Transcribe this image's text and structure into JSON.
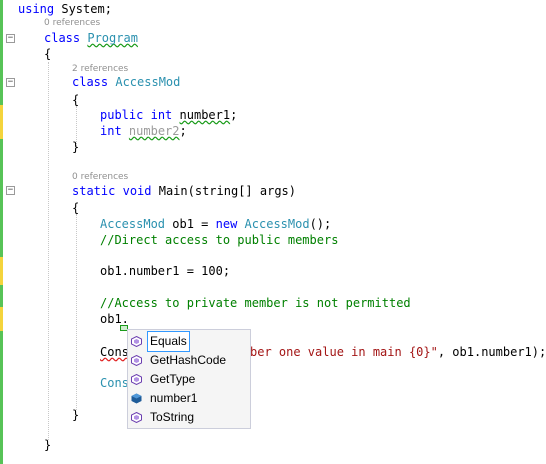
{
  "code": {
    "line_using": "using System;",
    "ref0": "0 references",
    "line_class_kw": "class",
    "line_class_name": "Program",
    "brace_open": "{",
    "brace_close": "}",
    "ref2": "2 references",
    "line_acc_kw": "class",
    "line_acc_name": "AccessMod",
    "public_kw": "public",
    "int_kw": "int",
    "number1_name": "number1",
    "semicolon": ";",
    "number2_name": "number2",
    "ref3": "0 references",
    "static_kw": "static",
    "void_kw": "void",
    "main_rest": "Main(string[] args)",
    "obj_type": "AccessMod",
    "obj_mid": "ob1 = ",
    "new_kw": "new",
    "obj_ctor": "AccessMod",
    "obj_end": "();",
    "comment1": "//Direct access to public members",
    "assign_line": "ob1.number1 = 100;",
    "comment2": "//Access to private member is not permitted",
    "ob1_dot": "ob1.",
    "cons_part": "Cons",
    "string_part": "ber one value in main {0}\"",
    "console_tail": ", ob1.number1);",
    "cons_part2": "Cons"
  },
  "completion": {
    "items": [
      {
        "label": "Equals",
        "icon": "method-icon"
      },
      {
        "label": "GetHashCode",
        "icon": "method-icon"
      },
      {
        "label": "GetType",
        "icon": "method-icon"
      },
      {
        "label": "number1",
        "icon": "field-icon"
      },
      {
        "label": "ToString",
        "icon": "method-icon"
      }
    ],
    "selected": "Equals"
  },
  "colors": {
    "keyword": "#0000ff",
    "type": "#2b91af",
    "comment": "#008000",
    "string": "#a31515",
    "selection_border": "#3399ff"
  }
}
